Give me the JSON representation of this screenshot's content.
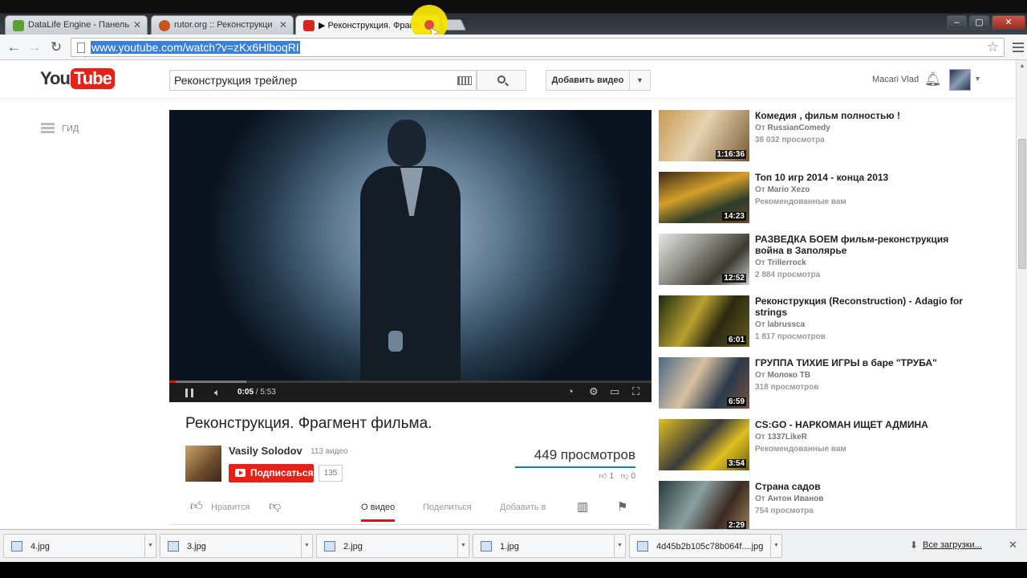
{
  "browser": {
    "tabs": [
      {
        "label": "DataLife Engine - Панель"
      },
      {
        "label": "rutor.org :: Реконструкци"
      },
      {
        "label": "▶ Реконструкция. Фрагм"
      }
    ],
    "url": "www.youtube.com/watch?v=zKx6HlboqRI"
  },
  "header": {
    "logo_you": "You",
    "logo_tube": "Tube",
    "search_query": "Реконструкция трейлер",
    "upload_label": "Добавить видео",
    "username": "Macari Vlad"
  },
  "guide": {
    "label": "ГИД"
  },
  "player": {
    "current_time": "0:05",
    "duration": "5:53",
    "progress_fraction": 0.014,
    "loaded_fraction": 0.16
  },
  "video": {
    "title": "Реконструкция. Фрагмент фильма.",
    "channel": "Vasily Solodov",
    "channel_videos": "113 видео",
    "subscribe_label": "Подписаться",
    "subscriber_count": "135",
    "views": "449 просмотров",
    "likes": "1",
    "dislikes": "0"
  },
  "actions": {
    "like_label": "Нравится",
    "about_label": "О видео",
    "share_label": "Поделиться",
    "add_label": "Добавить в"
  },
  "related": [
    {
      "title": "Комедия , фильм полностью !",
      "by": "От",
      "channel": "RussianComedy",
      "meta": "38 032 просмотра",
      "duration": "1:16:36"
    },
    {
      "title": "Топ 10 игр 2014 - конца 2013",
      "by": "От",
      "channel": "Mario Xezo",
      "meta": "Рекомендованные вам",
      "duration": "14:23"
    },
    {
      "title": "РАЗВЕДКА БОЕМ фильм-реконструкция война в Заполярье",
      "by": "От",
      "channel": "Trillerrock",
      "meta": "2 884 просмотра",
      "duration": "12:52"
    },
    {
      "title": "Реконструкция (Reconstruction) - Adagio for strings",
      "by": "От",
      "channel": "labrussca",
      "meta": "1 817 просмотров",
      "duration": "6:01"
    },
    {
      "title": "ГРУППА ТИХИЕ ИГРЫ в баре \"ТРУБА\"",
      "by": "От",
      "channel": "Молоко ТВ",
      "meta": "318 просмотров",
      "duration": "6:59"
    },
    {
      "title": "CS:GO - НАРКОМАН ИЩЕТ АДМИНА",
      "by": "От",
      "channel": "1337LikeR",
      "meta": "Рекомендованные вам",
      "duration": "3:54"
    },
    {
      "title": "Страна садов",
      "by": "От",
      "channel": "Антон Иванов",
      "meta": "754 просмотра",
      "duration": "2:29"
    }
  ],
  "downloads": {
    "files": [
      "4.jpg",
      "3.jpg",
      "2.jpg",
      "1.jpg",
      "4d45b2b105c78b064f....jpg"
    ],
    "all_label": "Все загрузки..."
  },
  "colors": {
    "accent": "#e62117",
    "link_blue": "#167ac6"
  }
}
